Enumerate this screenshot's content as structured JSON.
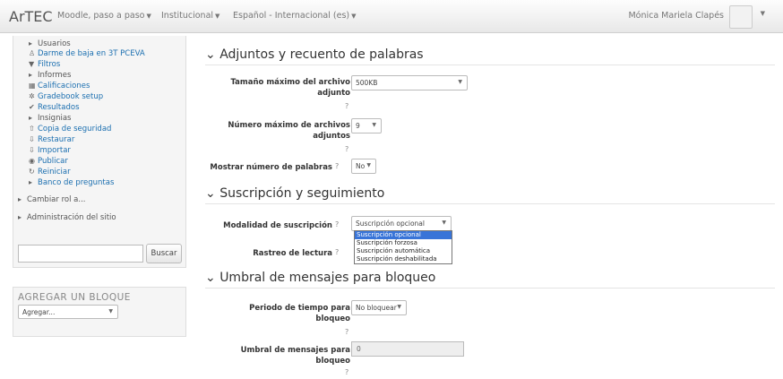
{
  "navbar": {
    "brand": "ArTEC",
    "items": [
      "Moodle, paso a paso",
      "Institucional",
      "Español - Internacional (es)"
    ],
    "user_name": "Mónica Mariela Clapés"
  },
  "sidebar": {
    "items": [
      {
        "label": "Usuarios",
        "icon": "triangle-right-icon"
      },
      {
        "label": "Darme de baja en 3T PCEVA",
        "icon": "user-icon"
      },
      {
        "label": "Filtros",
        "icon": "filter-icon"
      },
      {
        "label": "Informes",
        "icon": "triangle-right-icon"
      },
      {
        "label": "Calificaciones",
        "icon": "grades-icon"
      },
      {
        "label": "Gradebook setup",
        "icon": "gear-icon"
      },
      {
        "label": "Resultados",
        "icon": "check-icon"
      },
      {
        "label": "Insignias",
        "icon": "triangle-right-icon"
      },
      {
        "label": "Copia de seguridad",
        "icon": "upload-icon"
      },
      {
        "label": "Restaurar",
        "icon": "download-icon"
      },
      {
        "label": "Importar",
        "icon": "import-icon"
      },
      {
        "label": "Publicar",
        "icon": "publish-icon"
      },
      {
        "label": "Reiniciar",
        "icon": "reset-icon"
      },
      {
        "label": "Banco de preguntas",
        "icon": "triangle-right-icon"
      },
      {
        "label": "Cambiar rol a...",
        "icon": "triangle-right-icon"
      },
      {
        "label": "Administración del sitio",
        "icon": "triangle-right-icon"
      }
    ],
    "search_button": "Buscar",
    "add_block_title": "AGREGAR UN BLOQUE",
    "add_block_select": "Agregar..."
  },
  "main": {
    "section1_title": "Adjuntos y recuento de palabras",
    "max_size_label_1": "Tamaño máximo del archivo",
    "max_size_label_2": "adjunto",
    "max_size_value": "500KB",
    "max_files_label_1": "Número máximo de archivos",
    "max_files_label_2": "adjuntos",
    "max_files_value": "9",
    "show_words_label": "Mostrar número de palabras",
    "show_words_value": "No",
    "section2_title": "Suscripción y seguimiento",
    "subscription_label": "Modalidad de suscripción",
    "subscription_value": "Suscripción opcional",
    "subscription_options": [
      "Suscripción opcional",
      "Suscripción forzosa",
      "Suscripción automática",
      "Suscripción deshabilitada"
    ],
    "tracking_label": "Rastreo de lectura",
    "section3_title": "Umbral de mensajes para bloqueo",
    "period_label_1": "Periodo de tiempo para",
    "period_label_2": "bloqueo",
    "period_value": "No bloquear",
    "threshold_label_1": "Umbral de mensajes para",
    "threshold_label_2": "bloqueo",
    "threshold_value": "0"
  }
}
